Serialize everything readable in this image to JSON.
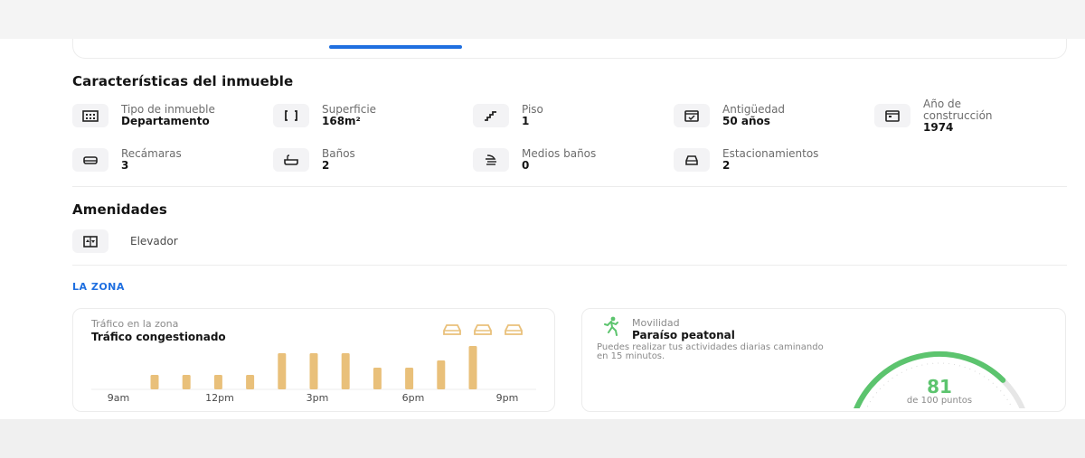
{
  "features_section": {
    "title": "Características del inmueble",
    "items": [
      {
        "icon": "building-icon",
        "label": "Tipo de inmueble",
        "value": "Departamento"
      },
      {
        "icon": "area-brackets-icon",
        "label": "Superficie",
        "value": "168m²"
      },
      {
        "icon": "stairs-icon",
        "label": "Piso",
        "value": "1"
      },
      {
        "icon": "calendar-check-icon",
        "label": "Antigüedad",
        "value": "50 años"
      },
      {
        "icon": "calendar-icon",
        "label": "Año de construcción",
        "value": "1974"
      },
      {
        "icon": "bed-icon",
        "label": "Recámaras",
        "value": "3"
      },
      {
        "icon": "bathtub-icon",
        "label": "Baños",
        "value": "2"
      },
      {
        "icon": "shower-icon",
        "label": "Medios baños",
        "value": "0"
      },
      {
        "icon": "car-icon",
        "label": "Estacionamientos",
        "value": "2"
      }
    ]
  },
  "amenities_section": {
    "title": "Amenidades",
    "items": [
      {
        "icon": "elevator-icon",
        "label": "Elevador"
      }
    ]
  },
  "zone": {
    "label": "LA ZONA",
    "traffic": {
      "subtitle": "Tráfico en la zona",
      "title": "Tráfico congestionado",
      "car_icons": 3,
      "bar_color": "#e9c07a",
      "tick_labels": [
        "9am",
        "12pm",
        "3pm",
        "6pm",
        "9pm"
      ]
    },
    "mobility": {
      "subtitle": "Movilidad",
      "title": "Paraíso peatonal",
      "description": "Puedes realizar tus actividades diarias caminando en 15 minutos.",
      "score": "81",
      "score_caption": "de 100 puntos",
      "score_fraction": 0.81,
      "accent": "#5cc46e"
    }
  },
  "chart_data": {
    "type": "bar",
    "title": "Tráfico congestionado",
    "x": [
      "10am",
      "11am",
      "12pm",
      "1pm",
      "2pm",
      "3pm",
      "4pm",
      "5pm",
      "6pm",
      "7pm",
      "8pm"
    ],
    "values": [
      2,
      2,
      2,
      2,
      5,
      5,
      5,
      3,
      3,
      4,
      6
    ],
    "xticks": [
      "9am",
      "12pm",
      "3pm",
      "6pm",
      "9pm"
    ],
    "ylim": [
      0,
      6
    ]
  },
  "colors": {
    "accent_blue": "#1f6fe0",
    "traffic_bar": "#e9c07a",
    "gauge_green": "#5cc46e"
  }
}
